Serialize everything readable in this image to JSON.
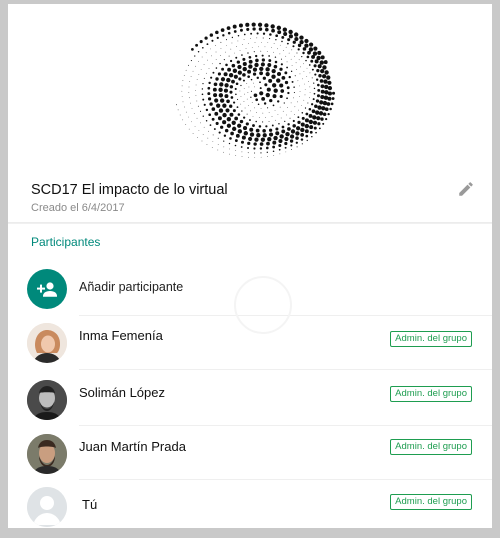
{
  "group": {
    "title": "SCD17 El impacto de lo virtual",
    "created": "Creado el 6/4/2017"
  },
  "participants": {
    "section_label": "Participantes",
    "add_label": "Añadir participante",
    "admin_badge": "Admin. del grupo",
    "list": [
      {
        "name": "Inma Femenía",
        "admin": true
      },
      {
        "name": "Solimán López",
        "admin": true
      },
      {
        "name": "Juan Martín Prada",
        "admin": true
      },
      {
        "name": "Tú",
        "admin": true
      }
    ]
  },
  "colors": {
    "accent": "#00897b",
    "admin_green": "#1e9d50",
    "add_circle": "#00897b"
  },
  "icons": {
    "edit": "pencil-icon",
    "add_participant": "add-person-icon"
  }
}
